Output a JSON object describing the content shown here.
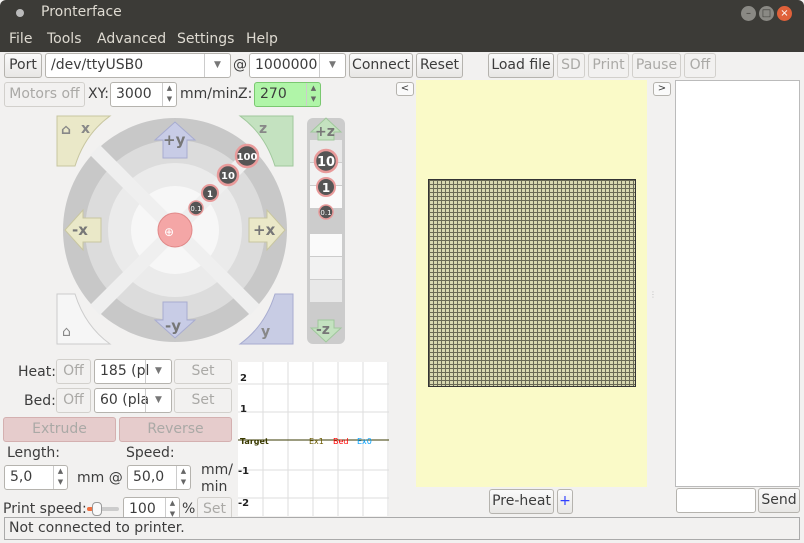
{
  "window": {
    "title": "Pronterface"
  },
  "menu": [
    "File",
    "Tools",
    "Advanced",
    "Settings",
    "Help"
  ],
  "toolbar": {
    "port_label": "Port",
    "port_value": "/dev/ttyUSB0",
    "at": "@",
    "baud_value": "1000000",
    "connect": "Connect",
    "reset": "Reset",
    "load_file": "Load file",
    "sd": "SD",
    "print": "Print",
    "pause": "Pause",
    "off": "Off"
  },
  "motion": {
    "motors_off": "Motors off",
    "xy_label": "XY:",
    "xy_value": "3000",
    "xy_unit": "mm/min",
    "z_label": "Z:",
    "z_value": "270",
    "collapse_left": "<",
    "collapse_right": ">"
  },
  "jog": {
    "home_x": "x",
    "home_z": "z",
    "home_y": "y",
    "plus_y": "+y",
    "minus_y": "-y",
    "plus_x": "+x",
    "minus_x": "-x",
    "steps": [
      "100",
      "10",
      "1",
      "0.1"
    ],
    "plus_z": "+z",
    "minus_z": "-z",
    "z_steps": [
      "10",
      "1",
      "0.1"
    ]
  },
  "temps": {
    "heat_label": "Heat:",
    "heat_off": "Off",
    "heat_value": "185 (pl",
    "heat_set": "Set",
    "bed_label": "Bed:",
    "bed_off": "Off",
    "bed_value": "60 (pla",
    "bed_set": "Set"
  },
  "extrude": {
    "extrude": "Extrude",
    "reverse": "Reverse",
    "length_label": "Length:",
    "length_value": "5,0",
    "mm_at": "mm @",
    "speed_label": "Speed:",
    "speed_value": "50,0",
    "speed_unit_1": "mm/",
    "speed_unit_2": "min",
    "print_speed_label": "Print speed:",
    "print_speed_value": "100",
    "percent": "%",
    "print_speed_set": "Set",
    "print_speed_slider": 0.1
  },
  "graph": {
    "yticks": [
      "2",
      "1",
      "-1",
      "-2"
    ],
    "legend": [
      {
        "name": "Target",
        "color": "#3a3a00"
      },
      {
        "name": "Ex1",
        "color": "#6b5a00"
      },
      {
        "name": "Bed",
        "color": "#ff0000"
      },
      {
        "name": "Ex0",
        "color": "#00a0ff"
      }
    ]
  },
  "plater": {
    "preheat": "Pre-heat",
    "plus": "+",
    "bg_color": "#fafac8"
  },
  "console": {
    "send": "Send",
    "input_value": ""
  },
  "status": "Not connected to printer."
}
